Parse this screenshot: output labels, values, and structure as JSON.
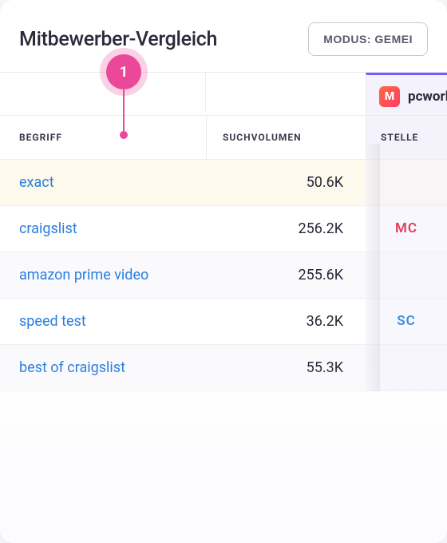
{
  "header": {
    "title": "Mitbewerber-Vergleich",
    "mode_button": "MODUS: GEMEI"
  },
  "annotation": {
    "number": "1"
  },
  "brand": {
    "icon_letter": "M",
    "name": "pcworld"
  },
  "columns": {
    "term": "BEGRIFF",
    "volume": "SUCHVOLUMEN",
    "position": "STELLE"
  },
  "rows": [
    {
      "term": "exact",
      "volume": "50.6K",
      "position": "",
      "pos_kind": "",
      "highlight": true
    },
    {
      "term": "craigslist",
      "volume": "256.2K",
      "position": "MC",
      "pos_kind": "red",
      "highlight": false
    },
    {
      "term": "amazon prime video",
      "volume": "255.6K",
      "position": "",
      "pos_kind": "",
      "highlight": false
    },
    {
      "term": "speed test",
      "volume": "36.2K",
      "position": "SC",
      "pos_kind": "blue",
      "highlight": false
    },
    {
      "term": "best of craigslist",
      "volume": "55.3K",
      "position": "",
      "pos_kind": "",
      "highlight": false
    }
  ]
}
